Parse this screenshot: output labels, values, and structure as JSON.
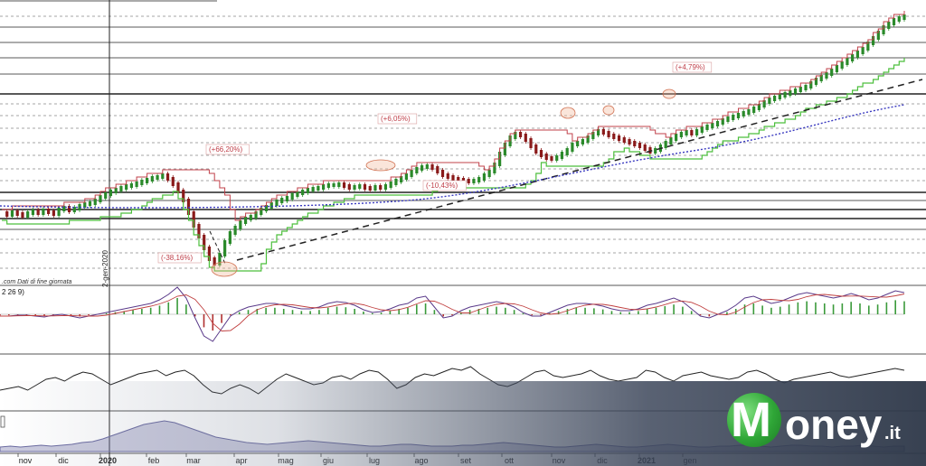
{
  "chart_data": {
    "type": "line",
    "title": "",
    "source_note": ".com Dati di fine giornata",
    "indicator_label": "2 26 9)",
    "vertical_marker_label": "2-gen-2020",
    "x_tick_labels": [
      "nov",
      "dic",
      "2020",
      "feb",
      "mar",
      "apr",
      "mag",
      "giu",
      "lug",
      "ago",
      "set",
      "ott",
      "nov",
      "dic",
      "2021",
      "gen"
    ],
    "annotations": [
      "(+66,20%)",
      "(-38,16%)",
      "(+6,05%)",
      "(-10,43%)",
      "(+4,79%)"
    ],
    "price_series": {
      "name": "",
      "values": [
        236,
        238,
        235,
        237,
        239,
        236,
        234,
        236,
        233,
        235,
        237,
        232,
        230,
        233,
        231,
        228,
        226,
        225,
        222,
        218,
        215,
        212,
        210,
        208,
        206,
        205,
        203,
        201,
        199,
        197,
        196,
        194,
        198,
        204,
        212,
        222,
        236,
        250,
        262,
        275,
        287,
        292,
        282,
        268,
        258,
        252,
        246,
        242,
        240,
        236,
        232,
        229,
        226,
        223,
        221,
        219,
        216,
        214,
        212,
        210,
        209,
        208,
        206,
        205,
        205,
        204,
        206,
        208,
        207,
        206,
        208,
        209,
        207,
        208,
        206,
        203,
        200,
        197,
        194,
        190,
        187,
        185,
        184,
        186,
        190,
        194,
        196,
        198,
        199,
        200,
        201,
        200,
        198,
        194,
        190,
        182,
        170,
        160,
        152,
        148,
        150,
        155,
        162,
        168,
        172,
        175,
        176,
        174,
        170,
        166,
        160,
        158,
        156,
        152,
        148,
        145,
        147,
        150,
        152,
        154,
        156,
        158,
        160,
        162,
        165,
        168,
        166,
        162,
        158,
        154,
        150,
        148,
        146,
        148,
        145,
        142,
        140,
        138,
        136,
        133,
        131,
        129,
        127,
        125,
        123,
        120,
        117,
        113,
        110,
        108,
        106,
        104,
        102,
        100,
        98,
        96,
        92,
        88,
        85,
        82,
        78,
        74,
        70,
        66,
        62,
        58,
        54,
        48,
        42,
        36,
        30,
        26,
        22,
        20,
        18
      ]
    },
    "macd_line": [
      350,
      350,
      349,
      349,
      350,
      351,
      349,
      348,
      350,
      352,
      350,
      348,
      346,
      344,
      342,
      340,
      338,
      336,
      332,
      326,
      318,
      330,
      352,
      372,
      378,
      364,
      350,
      344,
      340,
      338,
      336,
      336,
      338,
      340,
      342,
      342,
      340,
      336,
      334,
      335,
      338,
      343,
      346,
      345,
      342,
      338,
      336,
      330,
      328,
      340,
      352,
      350,
      344,
      340,
      338,
      336,
      334,
      336,
      340,
      346,
      350,
      350,
      346,
      342,
      338,
      336,
      336,
      337,
      339,
      342,
      344,
      344,
      342,
      338,
      336,
      333,
      330,
      334,
      342,
      350,
      352,
      348,
      344,
      338,
      330,
      328,
      332,
      336,
      334,
      330,
      326,
      324,
      326,
      328,
      330,
      328,
      325,
      328,
      332,
      330,
      326,
      322,
      324
    ],
    "rsi_line": [
      432,
      430,
      428,
      432,
      426,
      420,
      418,
      422,
      416,
      412,
      414,
      420,
      426,
      422,
      418,
      414,
      412,
      410,
      416,
      412,
      410,
      416,
      426,
      434,
      436,
      430,
      426,
      430,
      436,
      428,
      420,
      414,
      418,
      422,
      426,
      424,
      418,
      416,
      420,
      414,
      410,
      412,
      420,
      430,
      426,
      418,
      414,
      416,
      412,
      408,
      410,
      406,
      414,
      420,
      426,
      428,
      424,
      418,
      412,
      410,
      416,
      418,
      416,
      414,
      410,
      416,
      420,
      422,
      420,
      418,
      410,
      412,
      418,
      422,
      416,
      414,
      412,
      416,
      418,
      420,
      418,
      412,
      410,
      414,
      420,
      424,
      420,
      418,
      416,
      414,
      412,
      416,
      418,
      416,
      414,
      412,
      410,
      408,
      410
    ],
    "volume_area": [
      495,
      494,
      495,
      494,
      493,
      494,
      493,
      492,
      490,
      489,
      486,
      482,
      478,
      474,
      470,
      468,
      466,
      468,
      472,
      476,
      480,
      484,
      486,
      488,
      490,
      491,
      492,
      491,
      490,
      489,
      488,
      489,
      490,
      491,
      492,
      493,
      494,
      494,
      493,
      492,
      492,
      493,
      494,
      494,
      494,
      493,
      493,
      492,
      491,
      490,
      491,
      492,
      493,
      494,
      495,
      495,
      494,
      493,
      492,
      493,
      494,
      495,
      495,
      494,
      493,
      492,
      493,
      494,
      495,
      495,
      494,
      494,
      493,
      493,
      494,
      495,
      494,
      493,
      493,
      494,
      494,
      495,
      494,
      494,
      493,
      494,
      495,
      494,
      494
    ],
    "colors": {
      "price_up": "#2a8a2a",
      "price_down": "#8a1a1a",
      "resistance_line": "#c0404a",
      "support_line": "#4cbf3c",
      "trend_dashed": "#222222",
      "ma_dotted": "#3a3ac0",
      "annotation_text": "#c0404a",
      "macd": "#5a3a8a",
      "signal": "#c04040",
      "rsi": "#222222",
      "volume": "#6a6aa0"
    }
  },
  "logo": {
    "m": "M",
    "rest": "oney",
    "suffix": ".it"
  }
}
